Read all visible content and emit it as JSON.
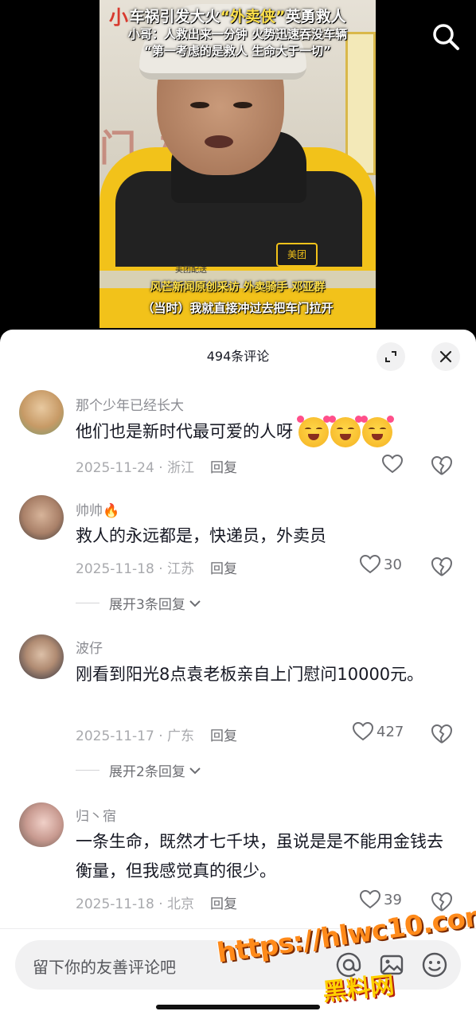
{
  "video": {
    "caption_top_marker": "小",
    "caption_line1_a": "车祸引发大火",
    "caption_line1_b": "“外卖侠”",
    "caption_line1_c": "英勇救人",
    "caption_line2": "小哥：人救出来一分钟 火势迅速吞没车辆",
    "caption_line3": "“第一考虑的是救人 生命大于一切”",
    "wall_text": "门 办",
    "badge": "美团",
    "jacket_logo": "美团配送",
    "subtitle_source": "风芒新闻原创采访 外卖骑手 邓亚群",
    "subtitle_quote": "（当时）我就直接冲过去把车门拉开",
    "icons": {
      "search": "search-icon"
    }
  },
  "sheet": {
    "title": "494条评论",
    "icons": {
      "expand": "expand-icon",
      "close": "close-icon"
    }
  },
  "comments": [
    {
      "username": "那个少年已经长大",
      "text": "他们也是新时代最可爱的人呀",
      "emoji_count": 3,
      "date": "2025-11-24",
      "location": "浙江",
      "reply_label": "回复",
      "likes": ""
    },
    {
      "username": "帅帅🔥",
      "text": "救人的永远都是，快递员，外卖员",
      "date": "2025-11-18",
      "location": "江苏",
      "reply_label": "回复",
      "likes": "30",
      "expand_label": "展开3条回复"
    },
    {
      "username": "波仔",
      "text": "刚看到阳光8点袁老板亲自上门慰问10000元。",
      "date": "2025-11-17",
      "location": "广东",
      "reply_label": "回复",
      "likes": "427",
      "expand_label": "展开2条回复"
    },
    {
      "username": "归丶宿",
      "text": "一条生命，既然才七千块，虽说是是不能用金钱去衡量，但我感觉真的很少。",
      "date": "2025-11-18",
      "location": "北京",
      "reply_label": "回复",
      "likes": "39"
    }
  ],
  "input": {
    "placeholder": "留下你的友善评论吧",
    "icons": [
      "at-icon",
      "image-icon",
      "emoji-icon"
    ]
  },
  "watermark": {
    "url": "https://hlwc10.com",
    "brand": "黑料网"
  },
  "colors": {
    "accent_yellow": "#f2c21a",
    "text_primary": "#161823",
    "text_secondary": "#8a8b91",
    "sheet_bg": "#ffffff"
  }
}
